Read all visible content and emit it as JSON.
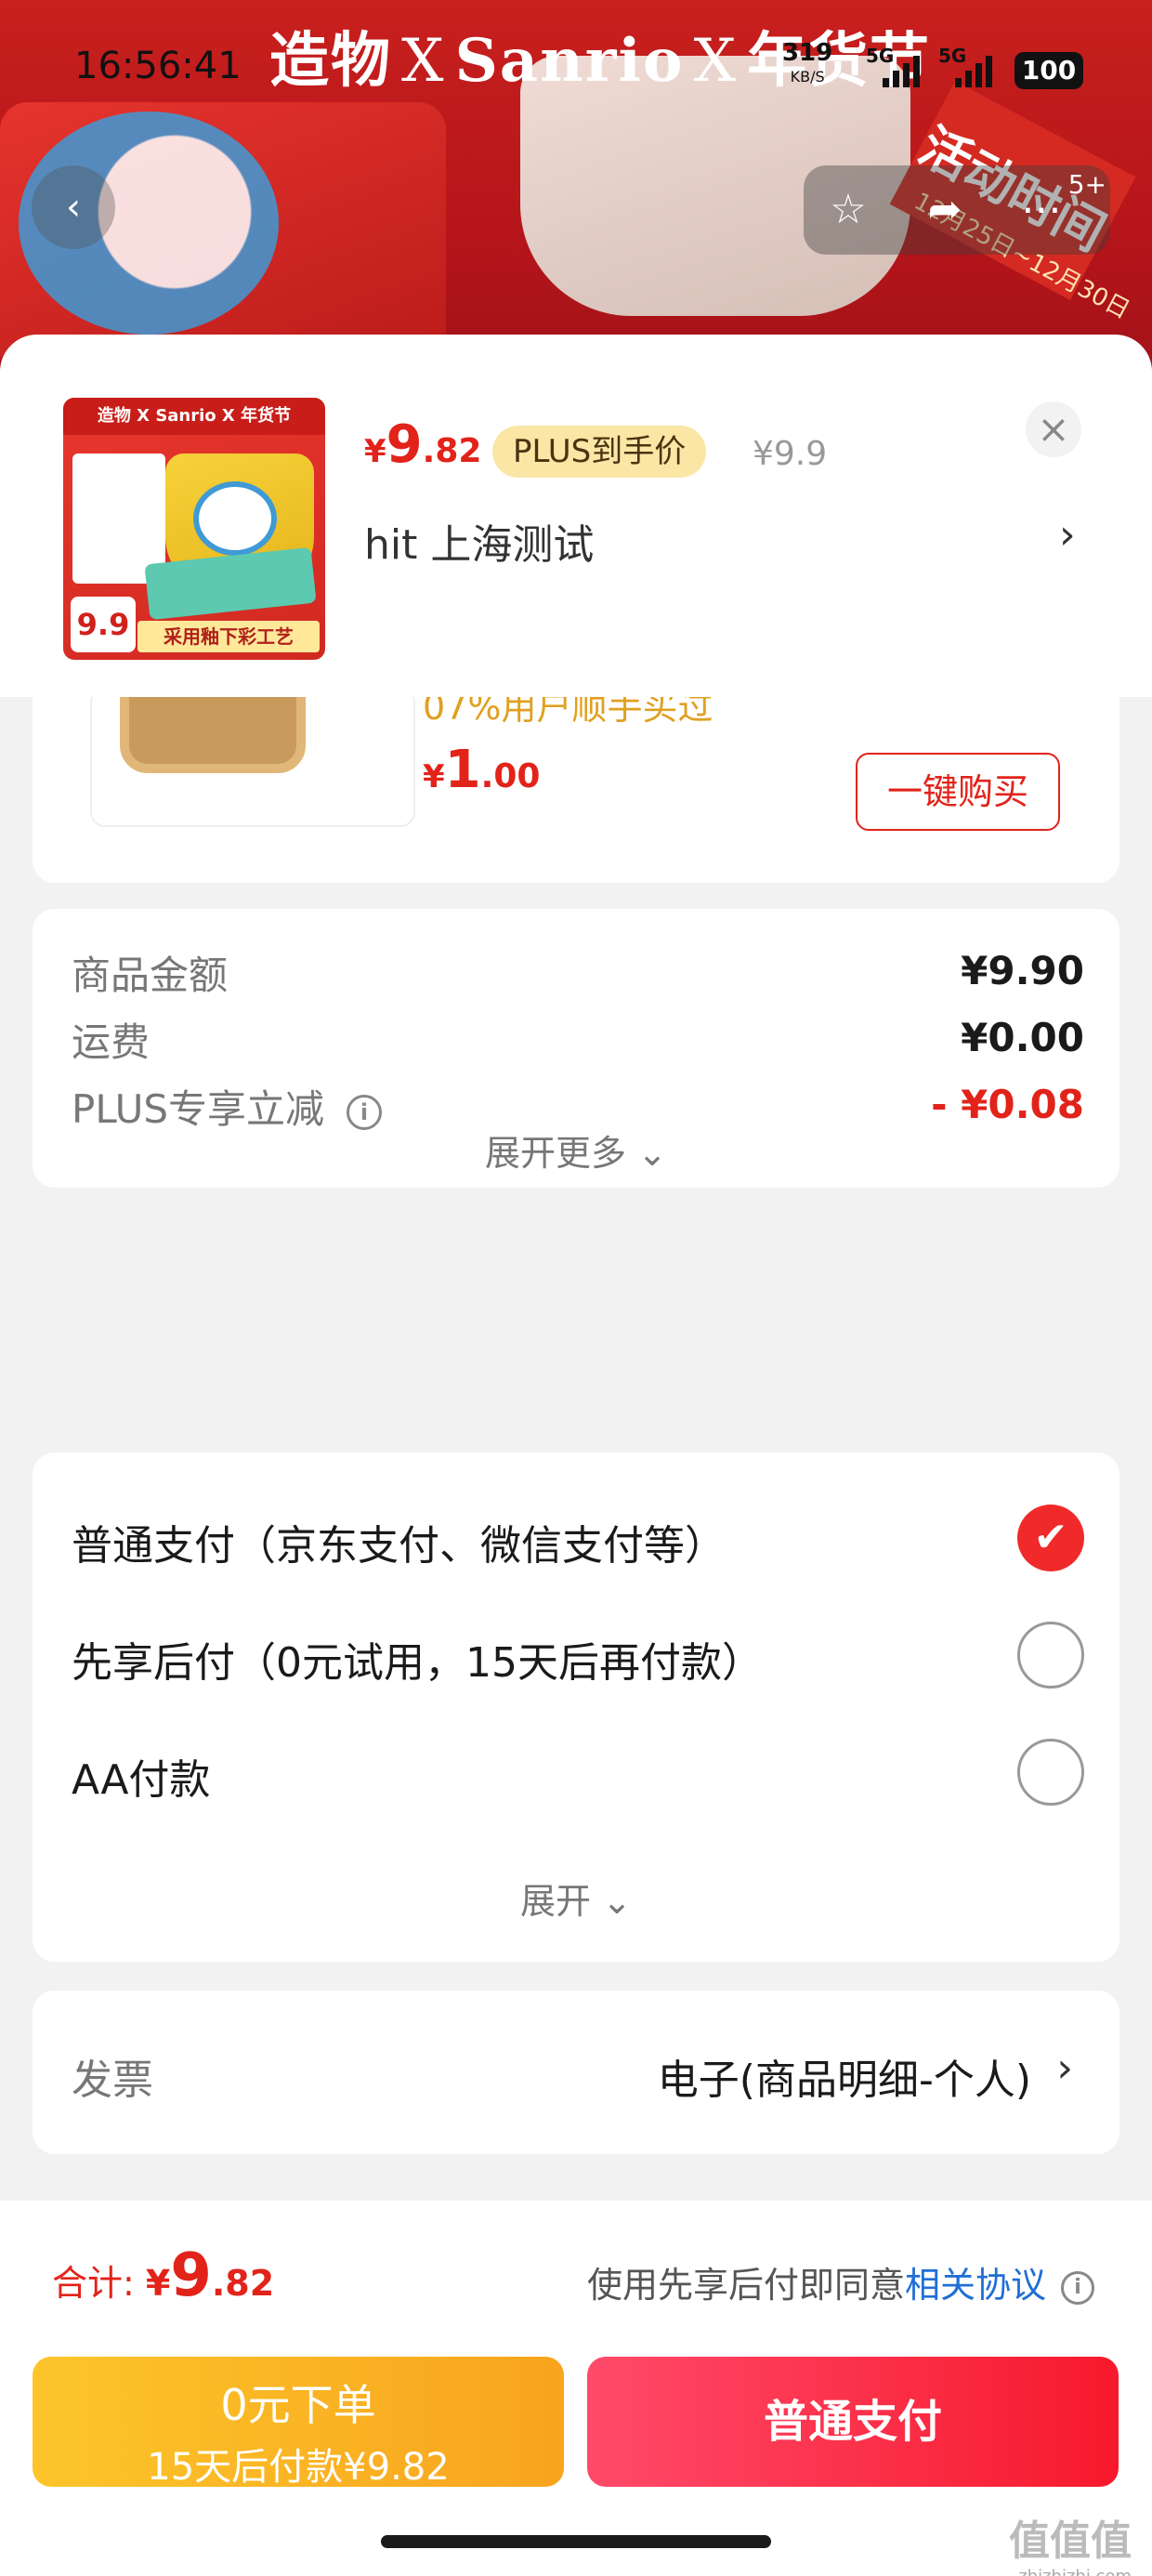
{
  "status_bar": {
    "time": "16:56:41",
    "speed": "319",
    "speed_unit": "KB/S",
    "net1": "5G",
    "net2": "5G",
    "battery": "100"
  },
  "hero": {
    "brand_left": "造物",
    "brand_x1": "X",
    "brand_mid": "Sanrio",
    "brand_x2": "X",
    "brand_right": "年货节",
    "event_label": "活动时间",
    "event_dates": "12月25日~12月30日",
    "nav_more_badge": "5+"
  },
  "product": {
    "thumb_top_text": "造物 X Sanrio X 年货节",
    "thumb_price": "9.9",
    "thumb_bottom_text": "采用釉下彩工艺",
    "price_currency": "¥",
    "price_int": "9",
    "price_dec": ".82",
    "plus_tag": "PLUS到手价",
    "original_price": "¥9.9",
    "close_icon": "×",
    "address": "hit  上海测试",
    "address_arrow": "›"
  },
  "recommend": {
    "promo_text": "07%用户顺手买过",
    "price_currency": "¥",
    "price_int": "1",
    "price_dec": ".00",
    "buy_button": "一键购买"
  },
  "amounts": {
    "rows": [
      {
        "label": "商品金额",
        "value": "¥9.90"
      },
      {
        "label": "运费",
        "value": "¥0.00"
      },
      {
        "label": "PLUS专享立减",
        "value": "- ¥0.08"
      }
    ],
    "info_icon": "i",
    "expand_label": "展开更多",
    "expand_icon": "⌄"
  },
  "payment": {
    "options": [
      {
        "label": "普通支付（京东支付、微信支付等）",
        "selected": true
      },
      {
        "label": "先享后付（0元试用，15天后再付款）",
        "selected": false
      },
      {
        "label": "AA付款",
        "selected": false
      }
    ],
    "check_icon": "✔",
    "expand_label": "展开",
    "expand_icon": "⌄"
  },
  "invoice": {
    "label": "发票",
    "value": "电子(商品明细-个人)",
    "arrow": "›"
  },
  "bottom": {
    "total_label": "合计: ",
    "total_currency": "¥",
    "total_int": "9",
    "total_dec": ".82",
    "agree_text": "使用先享后付即同意",
    "agree_link": "相关协议",
    "info_icon": "i",
    "zero_btn_line1": "0元下单",
    "zero_btn_line2": "15天后付款¥9.82",
    "pay_btn": "普通支付",
    "watermark": "值值值",
    "watermark_url": "zhizhizhi.com"
  },
  "colors": {
    "accent_red": "#e2231a",
    "plus_gold": "#fbe6a6",
    "link_blue": "#1f6fd6",
    "zero_btn": "#f8a41e",
    "pay_btn": "#f7192c"
  }
}
